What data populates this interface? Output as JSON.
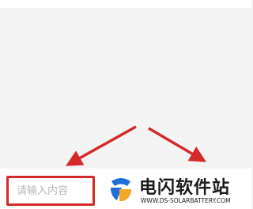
{
  "search": {
    "placeholder": "请输入内容",
    "value": ""
  },
  "watermark": {
    "title": "电闪软件站",
    "url": "WWW.DS-SOLARBATTERY.COM"
  },
  "colors": {
    "accent": "#d42a2a",
    "logo_blue": "#1e6fd9",
    "logo_orange": "#f5a623"
  },
  "icons": {
    "arrows": "red-arrow-icon",
    "logo": "site-logo-icon"
  }
}
